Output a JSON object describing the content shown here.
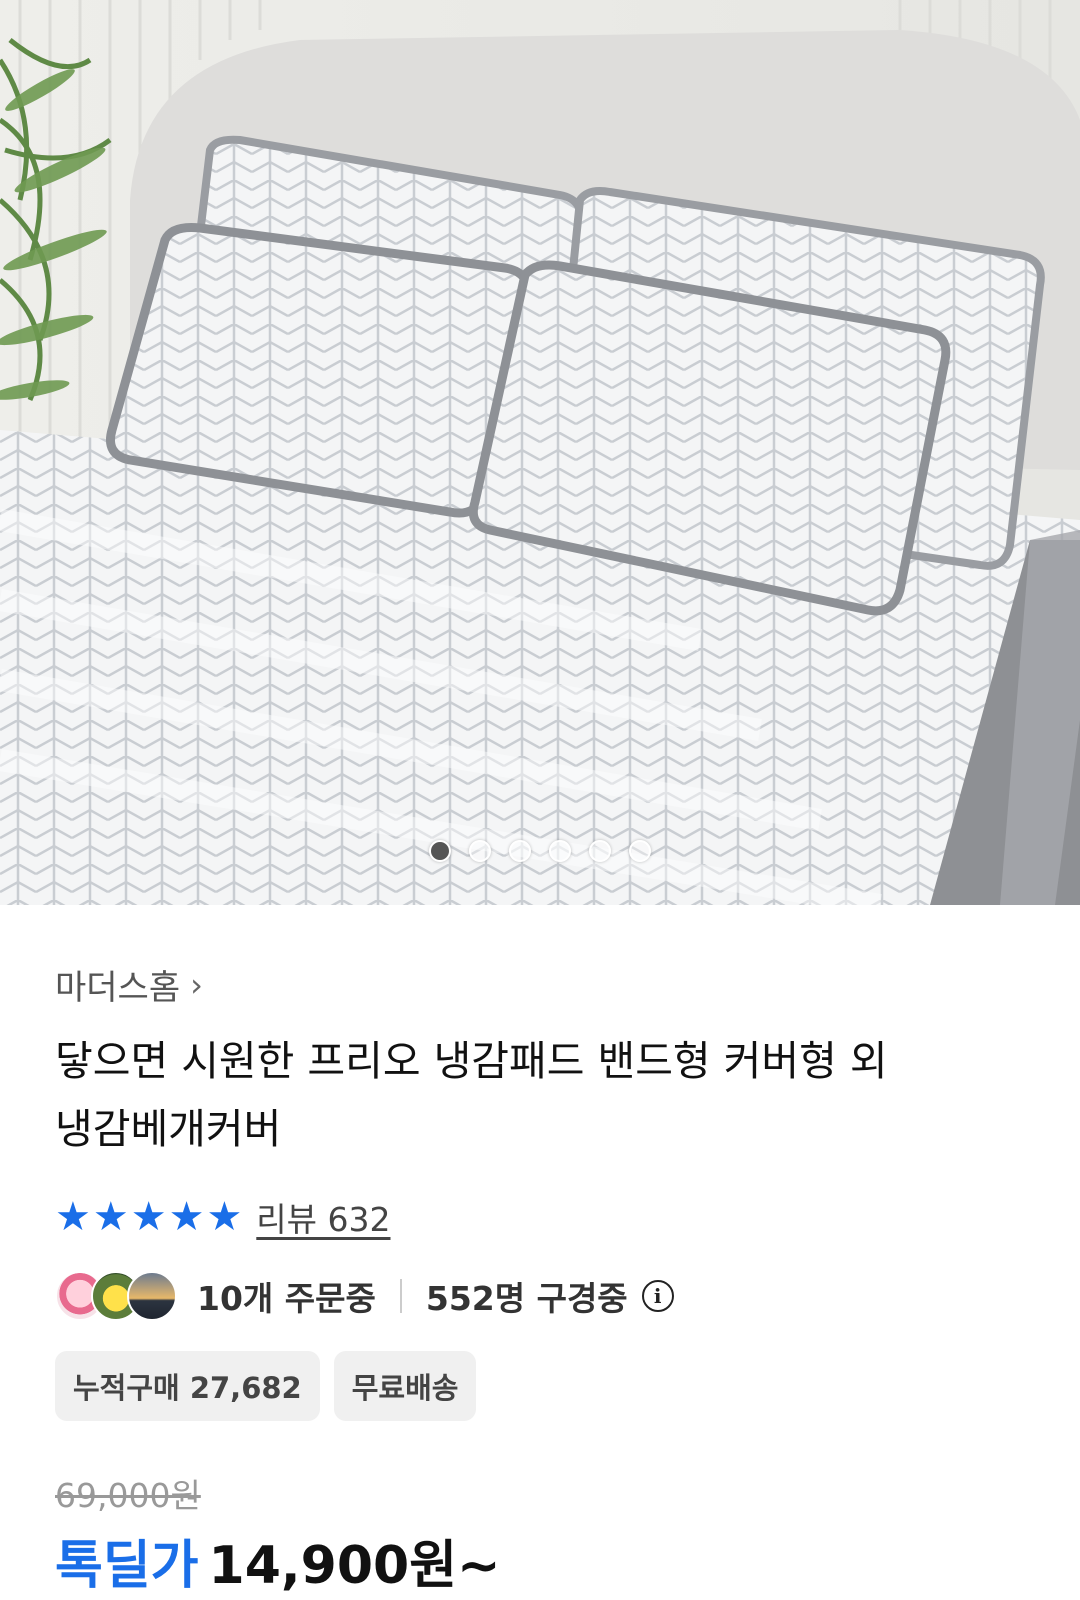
{
  "hero": {
    "image_alt": "cooling pad bed with four patterned pillows",
    "slides_total": 6,
    "slide_active": 1
  },
  "product": {
    "seller": "마더스홈",
    "title_line1": "닿으면 시원한 프리오 냉감패드 밴드형 커버형 외",
    "title_line2": "냉감베개커버",
    "rating_stars": 5,
    "review_label": "리뷰 632",
    "orders_label": "10개 주문중",
    "viewers_label": "552명 구경중",
    "chips": [
      "누적구매 27,682",
      "무료배송"
    ],
    "original_price": "69,000원",
    "deal_label": "톡딜가",
    "deal_price": "14,900원~"
  },
  "colors": {
    "accent": "#1a6ee8",
    "text": "#111111",
    "muted": "#999999",
    "chip_bg": "#f0f0f0"
  }
}
